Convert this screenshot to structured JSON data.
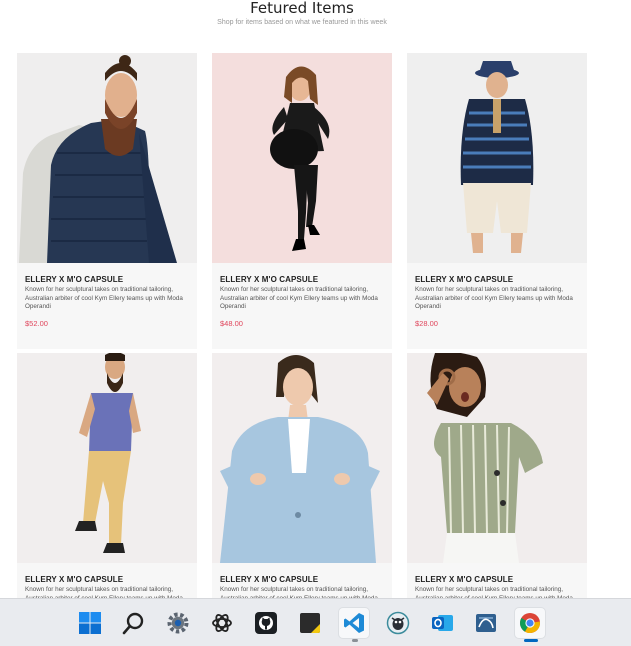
{
  "section": {
    "title": "Fetured Items",
    "subtitle": "Shop for items based on what we featured in this week"
  },
  "products": [
    {
      "title": "ELLERY X M'O CAPSULE",
      "description": "Known for her sculptural takes on traditional tailoring, Australian arbiter of cool Kym Ellery teams up with Moda Operandi",
      "price": "$52.00",
      "bg_color": "#efeeee"
    },
    {
      "title": "ELLERY X M'O CAPSULE",
      "description": "Known for her sculptural takes on traditional tailoring, Australian arbiter of cool Kym Ellery teams up with Moda Operandi",
      "price": "$48.00",
      "bg_color": "#f4dedd"
    },
    {
      "title": "ELLERY X M'O CAPSULE",
      "description": "Known for her sculptural takes on traditional tailoring, Australian arbiter of cool Kym Ellery teams up with Moda Operandi",
      "price": "$28.00",
      "bg_color": "#efefef"
    },
    {
      "title": "ELLERY X M'O CAPSULE",
      "description": "Known for her sculptural takes on traditional tailoring, Australian arbiter of cool Kym Ellery teams up with Moda Operandi",
      "price": "",
      "bg_color": "#f1eeee"
    },
    {
      "title": "ELLERY X M'O CAPSULE",
      "description": "Known for her sculptural takes on traditional tailoring, Australian arbiter of cool Kym Ellery teams up with Moda Operandi",
      "price": "",
      "bg_color": "#f2eeee"
    },
    {
      "title": "ELLERY X M'O CAPSULE",
      "description": "Known for her sculptural takes on traditional tailoring, Australian arbiter of cool Kym Ellery teams up with Moda Operandi",
      "price": "",
      "bg_color": "#f1eded"
    }
  ],
  "taskbar": {
    "icons": [
      {
        "name": "windows-start-icon",
        "active": false
      },
      {
        "name": "search-icon",
        "active": false
      },
      {
        "name": "settings-gear-icon",
        "active": false
      },
      {
        "name": "chatgpt-icon",
        "active": false
      },
      {
        "name": "github-icon",
        "active": false
      },
      {
        "name": "sticky-notes-icon",
        "active": false
      },
      {
        "name": "vscode-icon",
        "active": true
      },
      {
        "name": "git-client-icon",
        "active": false
      },
      {
        "name": "outlook-icon",
        "active": false
      },
      {
        "name": "mysql-workbench-icon",
        "active": false
      },
      {
        "name": "chrome-icon",
        "active": true
      }
    ]
  }
}
